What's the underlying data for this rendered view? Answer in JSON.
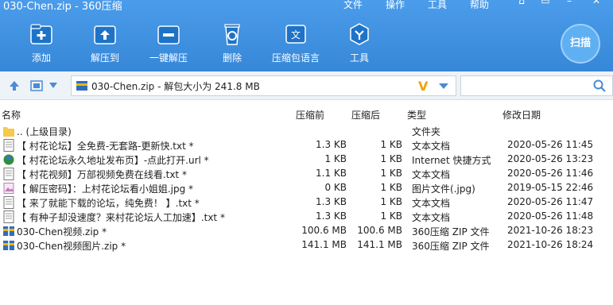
{
  "window": {
    "title": "030-Chen.zip - 360压缩",
    "menu": [
      "文件",
      "操作",
      "工具",
      "帮助"
    ]
  },
  "toolbar": {
    "items": [
      {
        "label": "添加",
        "icon": "add-icon"
      },
      {
        "label": "解压到",
        "icon": "extract-to-icon"
      },
      {
        "label": "一键解压",
        "icon": "one-click-extract-icon"
      },
      {
        "label": "删除",
        "icon": "recycle-bin-icon"
      },
      {
        "label": "压缩包语言",
        "icon": "language-icon"
      },
      {
        "label": "工具",
        "icon": "tools-icon"
      }
    ],
    "scan_label": "扫描"
  },
  "address": {
    "path_text": "030-Chen.zip - 解包大小为 241.8 MB",
    "search_placeholder": ""
  },
  "columns": {
    "name": "名称",
    "compressed": "压缩前",
    "packed": "压缩后",
    "type": "类型",
    "modified": "修改日期"
  },
  "files": [
    {
      "name": ".. (上级目录)",
      "before": "",
      "after": "",
      "type": "文件夹",
      "date": "",
      "icon": "folder-icon"
    },
    {
      "name": "【 村花论坛】全免费-无套路-更新快.txt *",
      "before": "1.3 KB",
      "after": "1 KB",
      "type": "文本文档",
      "date": "2020-05-26 11:45",
      "icon": "text-file-icon"
    },
    {
      "name": "【 村花论坛永久地址发布页】-点此打开.url *",
      "before": "1 KB",
      "after": "1 KB",
      "type": "Internet 快捷方式",
      "date": "2020-05-26 13:23",
      "icon": "globe-icon"
    },
    {
      "name": "【 村花视频】万部视频免费在线看.txt *",
      "before": "1.1 KB",
      "after": "1 KB",
      "type": "文本文档",
      "date": "2020-05-26 11:46",
      "icon": "text-file-icon"
    },
    {
      "name": "【 解压密码】：上村花论坛看小姐姐.jpg *",
      "before": "0 KB",
      "after": "1 KB",
      "type": "图片文件(.jpg)",
      "date": "2019-05-15 22:46",
      "icon": "image-file-icon"
    },
    {
      "name": "【 来了就能下载的论坛，纯免费！ 】.txt *",
      "before": "1.3 KB",
      "after": "1 KB",
      "type": "文本文档",
      "date": "2020-05-26 11:47",
      "icon": "text-file-icon"
    },
    {
      "name": "【 有种子却没速度？来村花论坛人工加速】.txt *",
      "before": "1.3 KB",
      "after": "1 KB",
      "type": "文本文档",
      "date": "2020-05-26 11:48",
      "icon": "text-file-icon"
    },
    {
      "name": "030-Chen视频.zip *",
      "before": "100.6 MB",
      "after": "100.6 MB",
      "type": "360压缩 ZIP 文件",
      "date": "2021-10-26 18:23",
      "icon": "zip-file-icon"
    },
    {
      "name": "030-Chen视频图片.zip *",
      "before": "141.1 MB",
      "after": "141.1 MB",
      "type": "360压缩 ZIP 文件",
      "date": "2021-10-26 18:24",
      "icon": "zip-file-icon"
    }
  ],
  "colors": {
    "toolbar_bg": "#3c8fe0",
    "accent": "#4a8bd6",
    "zip_icon": "#2f6fb8"
  }
}
